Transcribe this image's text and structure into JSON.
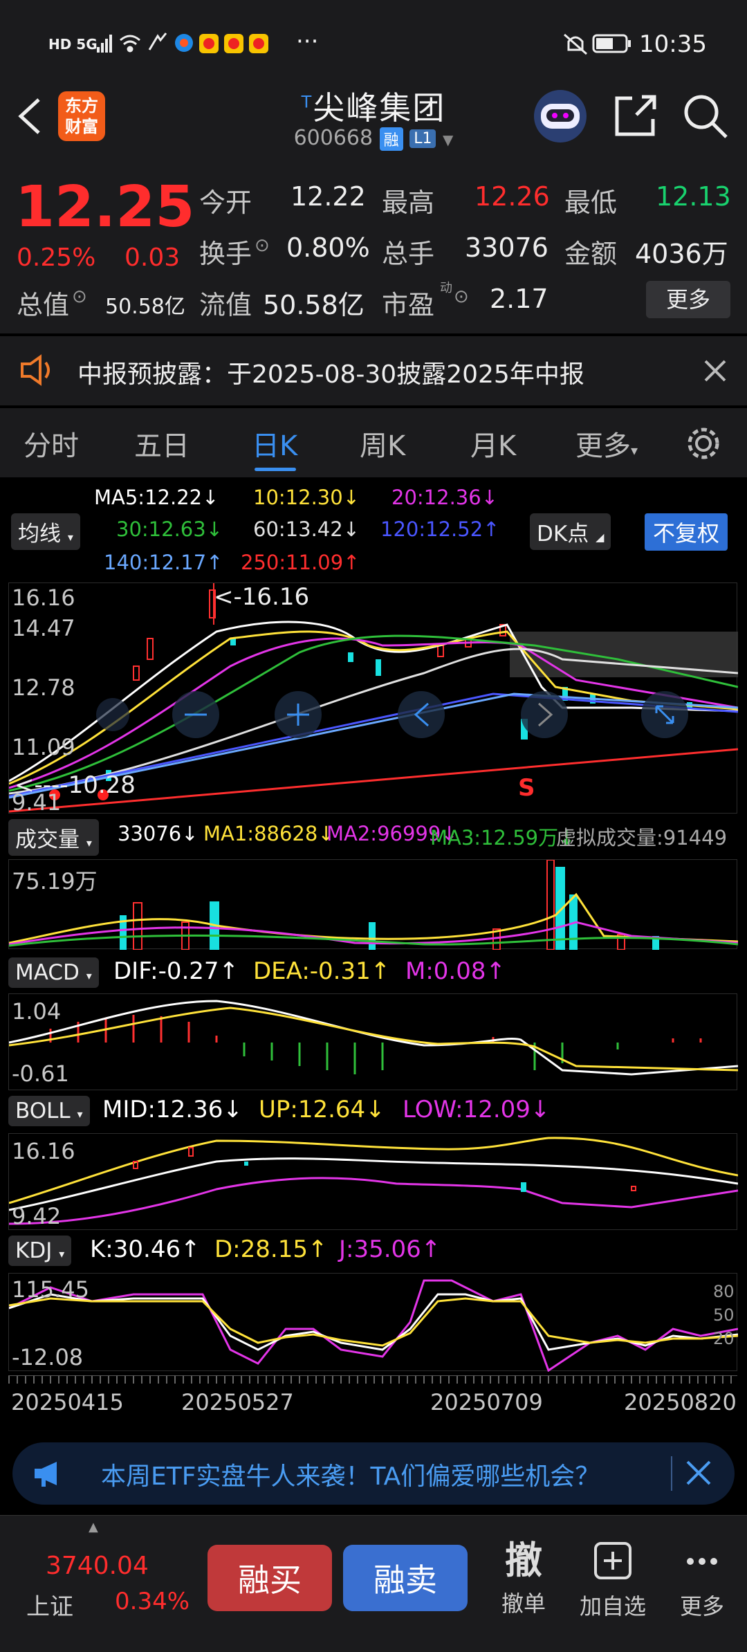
{
  "status_bar": {
    "time": "10:35",
    "left_icons": [
      "hd-icon",
      "5g-icon",
      "signal-icon",
      "wifi-icon",
      "nfc-icon",
      "app-icon",
      "weibo-icon",
      "weibo-icon",
      "weibo-icon",
      "more-dots-icon"
    ],
    "left_text": "HD 5G",
    "dots": "···"
  },
  "header": {
    "logo": "东方财富",
    "title_prefix": "T",
    "title": "尖峰集团",
    "code": "600668",
    "badge_rong": "融",
    "badge_level": "L1"
  },
  "quote": {
    "price": "12.25",
    "change_pct": "0.25%",
    "change_amt": "0.03",
    "open_label": "今开",
    "open": "12.22",
    "high_label": "最高",
    "high": "12.26",
    "low_label": "最低",
    "low": "12.13",
    "turnover_label": "换手",
    "turnover": "0.80%",
    "volume_label": "总手",
    "volume": "33076",
    "amount_label": "金额",
    "amount": "4036万",
    "mktcap_label": "总值",
    "mktcap": "50.58亿",
    "float_label": "流值",
    "float_cap": "50.58亿",
    "pe_label": "市盈",
    "pe_sup": "动",
    "pe": "2.17",
    "more_btn": "更多"
  },
  "notice": {
    "text": "中报预披露：于2025-08-30披露2025年中报"
  },
  "tabs": [
    "分时",
    "五日",
    "日K",
    "周K",
    "月K",
    "更多"
  ],
  "active_tab": "日K",
  "ma_legend": {
    "ma5": "MA5:12.22",
    "ma10": "10:12.30",
    "ma20": "20:12.36",
    "ma30": "30:12.63",
    "ma60": "60:13.42",
    "ma120": "120:12.52",
    "ma140": "140:12.17",
    "ma250": "250:11.09"
  },
  "selectors": {
    "indicator": "均线",
    "dk": "DK点",
    "fq": "不复权",
    "vol": "成交量",
    "macd": "MACD",
    "boll": "BOLL",
    "kdj": "KDJ"
  },
  "price_axis": {
    "y1": "16.16",
    "y2": "14.47",
    "y3": "12.78",
    "y4": "11.09",
    "y5": "9.41",
    "hi_mark": "<-16.16",
    "lo_mark": "<----10.28",
    "s_mark": "S"
  },
  "volume": {
    "vol": "33076",
    "ma1": "MA1:88628",
    "ma2": "MA2:96999",
    "ma3": "MA3:12.59万",
    "virtual": "虚拟成交量:91449",
    "axis_top": "75.19万"
  },
  "macd": {
    "dif": "DIF:-0.27",
    "dea": "DEA:-0.31",
    "m": "M:0.08",
    "axis_top": "1.04",
    "axis_bot": "-0.61"
  },
  "boll": {
    "mid": "MID:12.36",
    "up": "UP:12.64",
    "low": "LOW:12.09",
    "axis_top": "16.16",
    "axis_bot": "9.42"
  },
  "kdj": {
    "k": "K:30.46",
    "d": "D:28.15",
    "j": "J:35.06",
    "axis_top": "115.45",
    "axis_bot": "-12.08",
    "l80": "80",
    "l50": "50",
    "l20": "20"
  },
  "dates": [
    "20250415",
    "20250527",
    "20250709",
    "20250820"
  ],
  "banner": {
    "text": "本周ETF实盘牛人来袭！TA们偏爱哪些机会？"
  },
  "bottom": {
    "index_value": "3740.04",
    "index_name": "上证",
    "index_pct": "0.34%",
    "buy": "融买",
    "sell": "融卖",
    "cancel_icon": "撤",
    "cancel": "撤单",
    "add": "加自选",
    "more": "更多"
  },
  "colors": {
    "red": "#ff2d2d",
    "green": "#19d26e",
    "accent": "#3a8ff0",
    "ma5": "#ffffff",
    "ma10": "#ffe23a",
    "ma20": "#e335e8",
    "ma30": "#2fbf3a",
    "ma60": "#e0e0e0",
    "ma120": "#4a56ff",
    "ma140": "#6aa8ff",
    "ma250": "#ff2e2e"
  }
}
